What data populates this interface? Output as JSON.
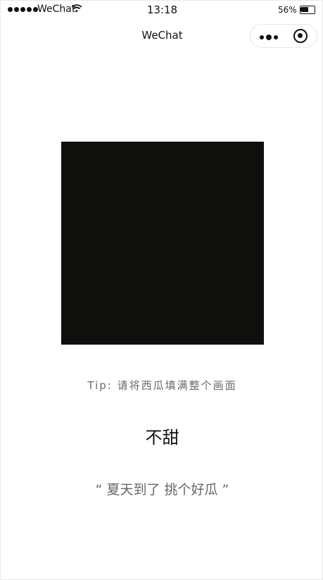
{
  "status_bar": {
    "carrier": "WeChat",
    "time": "13:18",
    "battery": "56%",
    "battery_level": 0.56,
    "wifi_icon": "wifi-icon",
    "signal_icon": "signal-dots-icon"
  },
  "nav": {
    "title": "WeChat",
    "more_icon": "more-dots-icon",
    "close_icon": "target-close-icon"
  },
  "main": {
    "tip": "Tip: 请将西瓜填满整个画面",
    "result": "不甜",
    "slogan": "“ 夏天到了 挑个好瓜 ”"
  },
  "colors": {
    "camera_bg": "#0f0f0e",
    "tip_text": "#6a6a6a",
    "slogan_text": "#666666"
  }
}
